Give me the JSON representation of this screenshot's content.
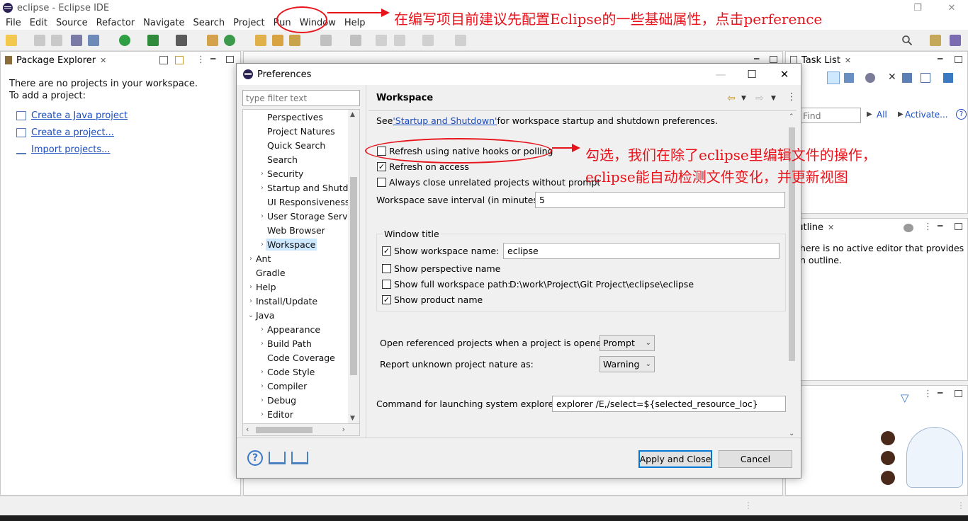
{
  "window": {
    "title": "eclipse - Eclipse IDE"
  },
  "menu": [
    "File",
    "Edit",
    "Source",
    "Refactor",
    "Navigate",
    "Search",
    "Project",
    "Run",
    "Window",
    "Help"
  ],
  "package_explorer": {
    "tab": "Package Explorer",
    "no_projects": "There are no projects in your workspace.",
    "to_add": "To add a project:",
    "links": [
      "Create a Java project",
      "Create a project...",
      "Import projects..."
    ]
  },
  "task_list": {
    "tab": "Task List",
    "find_placeholder": "Find",
    "all_label": "All",
    "activate_label": "Activate..."
  },
  "outline": {
    "tab": "Outline",
    "message_line1": "here is no active editor that provides",
    "message_line2": "n outline."
  },
  "dialog": {
    "title": "Preferences",
    "filter_placeholder": "type filter text",
    "tree": [
      {
        "label": "Perspectives",
        "arrow": ""
      },
      {
        "label": "Project Natures",
        "arrow": ""
      },
      {
        "label": "Quick Search",
        "arrow": ""
      },
      {
        "label": "Search",
        "arrow": ""
      },
      {
        "label": "Security",
        "arrow": "›"
      },
      {
        "label": "Startup and Shutdo",
        "arrow": "›"
      },
      {
        "label": "UI Responsiveness",
        "arrow": ""
      },
      {
        "label": "User Storage Servic",
        "arrow": "›"
      },
      {
        "label": "Web Browser",
        "arrow": ""
      },
      {
        "label": "Workspace",
        "arrow": "›"
      },
      {
        "label": "Ant",
        "arrow": "›"
      },
      {
        "label": "Gradle",
        "arrow": ""
      },
      {
        "label": "Help",
        "arrow": "›"
      },
      {
        "label": "Install/Update",
        "arrow": "›"
      },
      {
        "label": "Java",
        "arrow": "⌄"
      },
      {
        "label": "Appearance",
        "arrow": "›"
      },
      {
        "label": "Build Path",
        "arrow": "›"
      },
      {
        "label": "Code Coverage",
        "arrow": ""
      },
      {
        "label": "Code Style",
        "arrow": "›"
      },
      {
        "label": "Compiler",
        "arrow": "›"
      },
      {
        "label": "Debug",
        "arrow": "›"
      },
      {
        "label": "Editor",
        "arrow": "›"
      }
    ],
    "page": {
      "title": "Workspace",
      "see_prefix": "See ",
      "see_link": "'Startup and Shutdown'",
      "see_suffix": " for workspace startup and shutdown preferences.",
      "refresh_native": "Refresh using native hooks or polling",
      "refresh_access": "Refresh on access",
      "always_close": "Always close unrelated projects without prompt",
      "save_interval_label": "Workspace save interval (in minutes):",
      "save_interval_value": "5",
      "window_title_group": "Window title",
      "show_workspace_name": "Show workspace name:",
      "workspace_name_value": "eclipse",
      "show_perspective_name": "Show perspective name",
      "show_full_path": "Show full workspace path:",
      "full_path_value": "D:\\work\\Project\\Git Project\\eclipse\\eclipse",
      "show_product_name": "Show product name",
      "open_referenced_label": "Open referenced projects when a project is opened:",
      "open_referenced_value": "Prompt",
      "report_unknown_label": "Report unknown project nature as:",
      "report_unknown_value": "Warning",
      "command_label": "Command for launching system explorer:",
      "command_value": "explorer /E,/select=${selected_resource_loc}"
    },
    "checks": {
      "refresh_native": false,
      "refresh_access": true,
      "always_close": false,
      "show_workspace_name": true,
      "show_perspective_name": false,
      "show_full_path": false,
      "show_product_name": true
    },
    "buttons": {
      "apply_close": "Apply and Close",
      "cancel": "Cancel"
    }
  },
  "annotations": {
    "top": "在编写项目前建议先配置Eclipse的一些基础属性，点击perference",
    "middle_line1": "勾选，我们在除了eclipse里编辑文件的操作，",
    "middle_line2": "eclipse能自动检测文件变化，并更新视图"
  },
  "colors": {
    "annotation_red": "#e8141c",
    "link_blue": "#1a4bbf",
    "selection": "#cde8ff"
  }
}
